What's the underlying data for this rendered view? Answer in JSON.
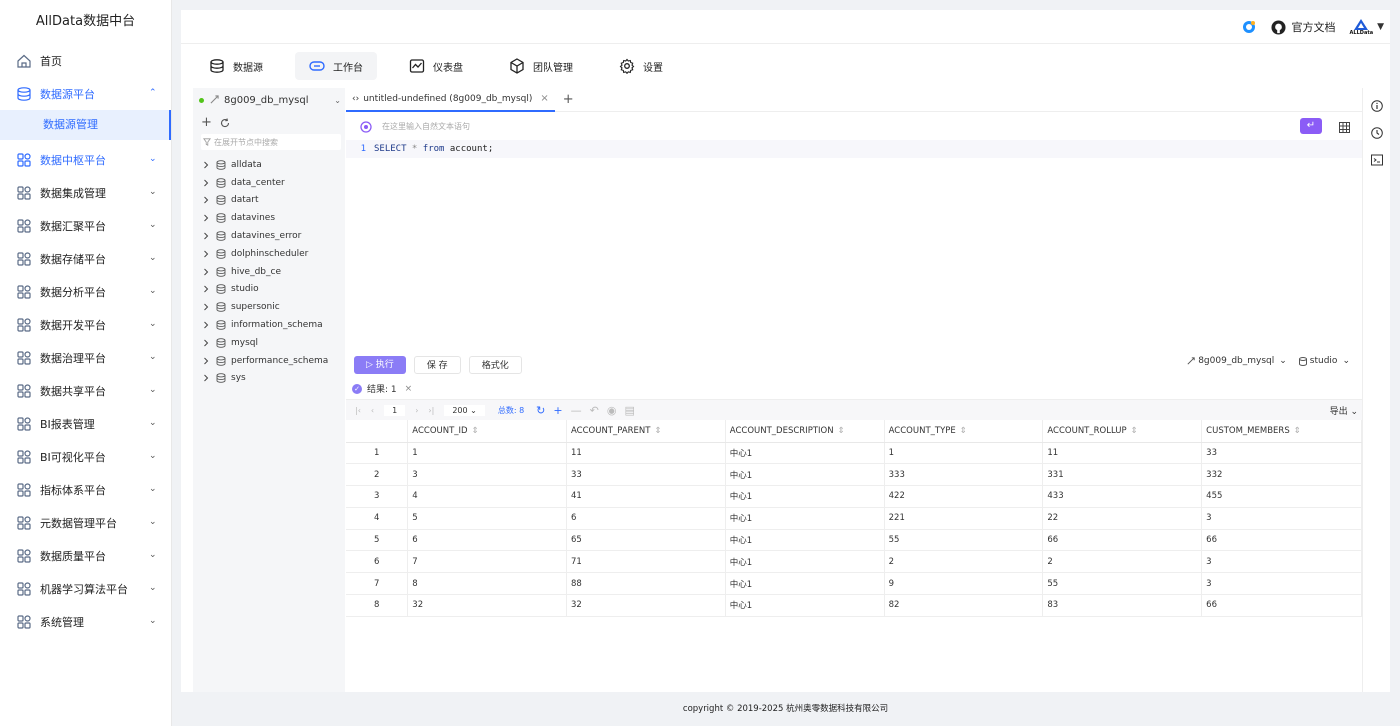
{
  "app": {
    "title": "AllData数据中台"
  },
  "sidebar": {
    "items": [
      {
        "label": "首页",
        "icon": "home-icon"
      },
      {
        "label": "数据源平台",
        "icon": "database-icon",
        "expanded": true,
        "active": true
      },
      {
        "label": "数据中枢平台",
        "icon": "hub-icon",
        "active": true
      },
      {
        "label": "数据集成管理",
        "icon": "integration-icon"
      },
      {
        "label": "数据汇聚平台",
        "icon": "aggregate-icon"
      },
      {
        "label": "数据存储平台",
        "icon": "storage-icon"
      },
      {
        "label": "数据分析平台",
        "icon": "analysis-icon"
      },
      {
        "label": "数据开发平台",
        "icon": "develop-icon"
      },
      {
        "label": "数据治理平台",
        "icon": "governance-icon"
      },
      {
        "label": "数据共享平台",
        "icon": "share-icon"
      },
      {
        "label": "BI报表管理",
        "icon": "report-icon"
      },
      {
        "label": "BI可视化平台",
        "icon": "visual-icon"
      },
      {
        "label": "指标体系平台",
        "icon": "metric-icon"
      },
      {
        "label": "元数据管理平台",
        "icon": "metadata-icon"
      },
      {
        "label": "数据质量平台",
        "icon": "quality-icon"
      },
      {
        "label": "机器学习算法平台",
        "icon": "ml-icon"
      },
      {
        "label": "系统管理",
        "icon": "system-icon"
      }
    ],
    "submenu": {
      "label": "数据源管理"
    }
  },
  "topbar": {
    "docs_label": "官方文档",
    "brand_label": "ALLData"
  },
  "nav_tabs": [
    {
      "label": "数据源",
      "icon": "database-icon"
    },
    {
      "label": "工作台",
      "icon": "link-icon",
      "active": true
    },
    {
      "label": "仪表盘",
      "icon": "dashboard-icon"
    },
    {
      "label": "团队管理",
      "icon": "cube-icon"
    },
    {
      "label": "设置",
      "icon": "gear-icon"
    }
  ],
  "tree": {
    "connection": "8g009_db_mysql",
    "search_placeholder": "在展开节点中搜索",
    "databases": [
      "alldata",
      "data_center",
      "datart",
      "datavines",
      "datavines_error",
      "dolphinscheduler",
      "hive_db_ce",
      "studio",
      "supersonic",
      "information_schema",
      "mysql",
      "performance_schema",
      "sys"
    ]
  },
  "editor": {
    "tab_label": "untitled-undefined (8g009_db_mysql)",
    "ai_placeholder": "在这里输入自然文本语句",
    "line_number": "1",
    "sql": {
      "kw1": "SELECT",
      "star": " * ",
      "kw2": "from",
      "rest": " account;"
    }
  },
  "actions": {
    "run": "执行",
    "save": "保 存",
    "format": "格式化",
    "connection": "8g009_db_mysql",
    "database": "studio"
  },
  "result": {
    "tab_label": "结果: 1",
    "page": "1",
    "page_size": "200",
    "total": "总数: 8",
    "export": "导出",
    "columns": [
      "ACCOUNT_ID",
      "ACCOUNT_PARENT",
      "ACCOUNT_DESCRIPTION",
      "ACCOUNT_TYPE",
      "ACCOUNT_ROLLUP",
      "CUSTOM_MEMBERS"
    ],
    "rows": [
      [
        "1",
        "1",
        "11",
        "中心1",
        "1",
        "11",
        "33"
      ],
      [
        "2",
        "3",
        "33",
        "中心1",
        "333",
        "331",
        "332"
      ],
      [
        "3",
        "4",
        "41",
        "中心1",
        "422",
        "433",
        "455"
      ],
      [
        "4",
        "5",
        "6",
        "中心1",
        "221",
        "22",
        "3"
      ],
      [
        "5",
        "6",
        "65",
        "中心1",
        "55",
        "66",
        "66"
      ],
      [
        "6",
        "7",
        "71",
        "中心1",
        "2",
        "2",
        "3"
      ],
      [
        "7",
        "8",
        "88",
        "中心1",
        "9",
        "55",
        "3"
      ],
      [
        "8",
        "32",
        "32",
        "中心1",
        "82",
        "83",
        "66"
      ]
    ]
  },
  "footer": {
    "text": "copyright © 2019-2025 杭州奥零数据科技有限公司"
  },
  "colors": {
    "accent": "#2f6bff",
    "run_button": "#8b7cf6",
    "submenu_bg": "#e8f0fe"
  }
}
